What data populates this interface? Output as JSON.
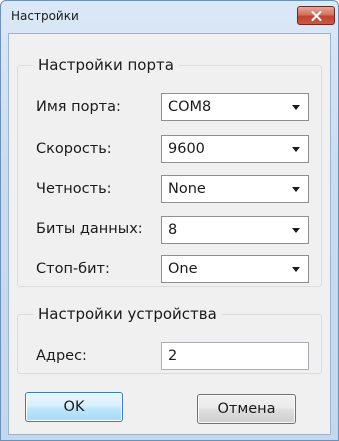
{
  "window": {
    "title": "Настройки",
    "close_icon": "close-x-icon"
  },
  "port_settings": {
    "group_title": "Настройки порта",
    "port_name": {
      "label": "Имя порта:",
      "value": "COM8"
    },
    "baud_rate": {
      "label": "Скорость:",
      "value": "9600"
    },
    "parity": {
      "label": "Четность:",
      "value": "None"
    },
    "data_bits": {
      "label": "Биты данных:",
      "value": "8"
    },
    "stop_bits": {
      "label": "Стоп-бит:",
      "value": "One"
    }
  },
  "device_settings": {
    "group_title": "Настройки устройства",
    "address": {
      "label": "Адрес:",
      "value": "2"
    }
  },
  "buttons": {
    "ok_label": "OK",
    "cancel_label": "Отмена"
  },
  "colors": {
    "close_button": "#c95a45",
    "ok_button_border": "#3c7fb1",
    "dialog_background": "#f0f0f0"
  }
}
